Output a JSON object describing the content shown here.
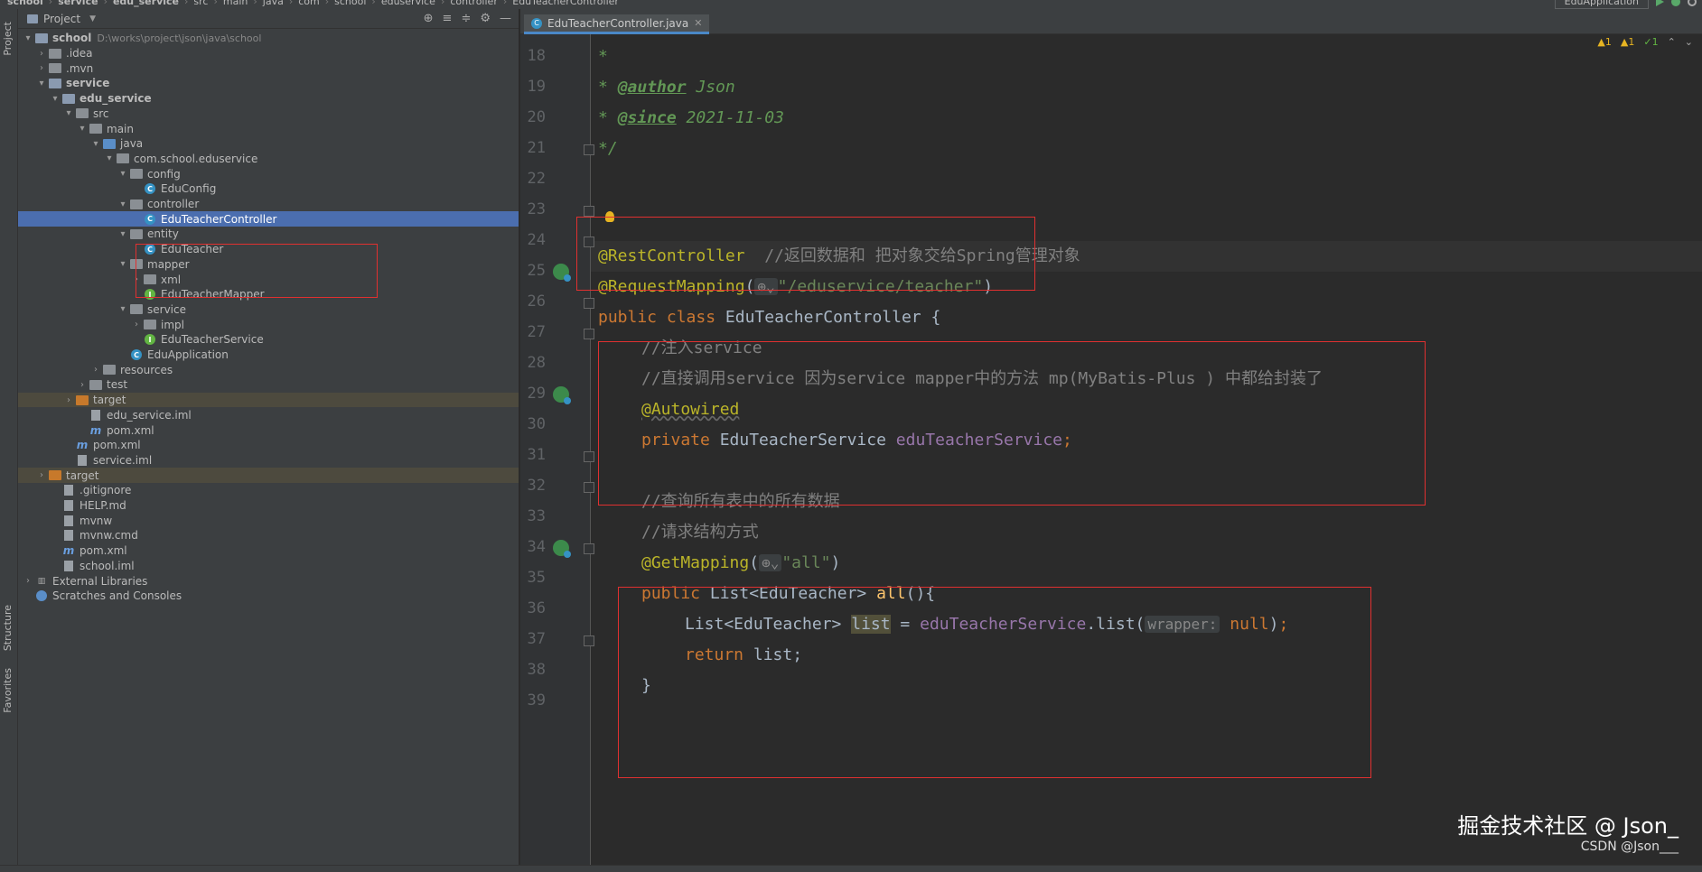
{
  "breadcrumb": [
    "school",
    "service",
    "edu_service",
    "src",
    "main",
    "java",
    "com",
    "school",
    "eduservice",
    "controller",
    "EduTeacherController"
  ],
  "run_config": "EduApplication",
  "left_stripe": {
    "project": "Project",
    "structure": "Structure",
    "favorites": "Favorites"
  },
  "project_panel": {
    "title": "Project"
  },
  "tree": [
    {
      "label": "school",
      "path": "D:\\works\\project\\json\\java\\school",
      "depth": 0,
      "arrow": "▾",
      "icon": "module-folder",
      "bold": true
    },
    {
      "label": ".idea",
      "depth": 1,
      "arrow": "›",
      "icon": "folder"
    },
    {
      "label": ".mvn",
      "depth": 1,
      "arrow": "›",
      "icon": "folder"
    },
    {
      "label": "service",
      "depth": 1,
      "arrow": "▾",
      "icon": "module-folder",
      "bold": true
    },
    {
      "label": "edu_service",
      "depth": 2,
      "arrow": "▾",
      "icon": "module-folder",
      "bold": true
    },
    {
      "label": "src",
      "depth": 3,
      "arrow": "▾",
      "icon": "folder"
    },
    {
      "label": "main",
      "depth": 4,
      "arrow": "▾",
      "icon": "folder"
    },
    {
      "label": "java",
      "depth": 5,
      "arrow": "▾",
      "icon": "folder-blue"
    },
    {
      "label": "com.school.eduservice",
      "depth": 6,
      "arrow": "▾",
      "icon": "folder"
    },
    {
      "label": "config",
      "depth": 7,
      "arrow": "▾",
      "icon": "folder"
    },
    {
      "label": "EduConfig",
      "depth": 8,
      "arrow": "",
      "icon": "class"
    },
    {
      "label": "controller",
      "depth": 7,
      "arrow": "▾",
      "icon": "folder"
    },
    {
      "label": "EduTeacherController",
      "depth": 8,
      "arrow": "",
      "icon": "class",
      "selected": true
    },
    {
      "label": "entity",
      "depth": 7,
      "arrow": "▾",
      "icon": "folder"
    },
    {
      "label": "EduTeacher",
      "depth": 8,
      "arrow": "",
      "icon": "class"
    },
    {
      "label": "mapper",
      "depth": 7,
      "arrow": "▾",
      "icon": "folder"
    },
    {
      "label": "xml",
      "depth": 8,
      "arrow": "›",
      "icon": "folder"
    },
    {
      "label": "EduTeacherMapper",
      "depth": 8,
      "arrow": "",
      "icon": "interface"
    },
    {
      "label": "service",
      "depth": 7,
      "arrow": "▾",
      "icon": "folder"
    },
    {
      "label": "impl",
      "depth": 8,
      "arrow": "›",
      "icon": "folder"
    },
    {
      "label": "EduTeacherService",
      "depth": 8,
      "arrow": "",
      "icon": "interface"
    },
    {
      "label": "EduApplication",
      "depth": 7,
      "arrow": "",
      "icon": "class"
    },
    {
      "label": "resources",
      "depth": 5,
      "arrow": "›",
      "icon": "folder"
    },
    {
      "label": "test",
      "depth": 4,
      "arrow": "›",
      "icon": "folder"
    },
    {
      "label": "target",
      "depth": 3,
      "arrow": "›",
      "icon": "folder-orange",
      "excluded": true
    },
    {
      "label": "edu_service.iml",
      "depth": 4,
      "arrow": "",
      "icon": "file"
    },
    {
      "label": "pom.xml",
      "depth": 4,
      "arrow": "",
      "icon": "maven"
    },
    {
      "label": "pom.xml",
      "depth": 3,
      "arrow": "",
      "icon": "maven"
    },
    {
      "label": "service.iml",
      "depth": 3,
      "arrow": "",
      "icon": "file"
    },
    {
      "label": "target",
      "depth": 1,
      "arrow": "›",
      "icon": "folder-orange",
      "excluded": true
    },
    {
      "label": ".gitignore",
      "depth": 2,
      "arrow": "",
      "icon": "file"
    },
    {
      "label": "HELP.md",
      "depth": 2,
      "arrow": "",
      "icon": "file"
    },
    {
      "label": "mvnw",
      "depth": 2,
      "arrow": "",
      "icon": "file"
    },
    {
      "label": "mvnw.cmd",
      "depth": 2,
      "arrow": "",
      "icon": "file"
    },
    {
      "label": "pom.xml",
      "depth": 2,
      "arrow": "",
      "icon": "maven"
    },
    {
      "label": "school.iml",
      "depth": 2,
      "arrow": "",
      "icon": "file"
    },
    {
      "label": "External Libraries",
      "depth": 0,
      "arrow": "›",
      "icon": "libs"
    },
    {
      "label": "Scratches and Consoles",
      "depth": 0,
      "arrow": "",
      "icon": "scratch"
    }
  ],
  "editor": {
    "tab_label": "EduTeacherController.java",
    "inspections": {
      "warn1": "1",
      "warn2": "1",
      "ok": "1"
    },
    "line_numbers": [
      "18",
      "19",
      "20",
      "21",
      "22",
      "23",
      "24",
      "25",
      "26",
      "27",
      "28",
      "29",
      "30",
      "31",
      "32",
      "33",
      "34",
      "35",
      "36",
      "37",
      "38",
      "39"
    ],
    "code": {
      "l18": "*",
      "l19_tag": "@author",
      "l19_rest": " Json",
      "l20_tag": "@since",
      "l20_rest": " 2021-11-03",
      "l21": "*/",
      "l23_ann": "@RestController",
      "l23_cmt": "  //返回数据和 把对象交给Spring管理对象",
      "l24_ann": "@RequestMapping",
      "l24_str": "\"/eduservice/teacher\"",
      "l25_kw": "public class ",
      "l25_name": "EduTeacherController {",
      "l26": "//注入service",
      "l27": "//直接调用service 因为service mapper中的方法 mp(MyBatis-Plus ) 中都给封装了",
      "l28": "@Autowired",
      "l29_kw": "private ",
      "l29_type": "EduTeacherService ",
      "l29_field": "eduTeacherService",
      "l31": "//查询所有表中的所有数据",
      "l32": "//请求结构方式",
      "l33_ann": "@GetMapping",
      "l33_str": "\"all\"",
      "l34_kw": "public ",
      "l34_type": "List<EduTeacher> ",
      "l34_fn": "all",
      "l35_type": "List<EduTeacher> ",
      "l35_var": "list",
      "l35_field": "eduTeacherService",
      "l35_call": ".list(",
      "l35_hint": "wrapper:",
      "l35_null": "null",
      "l36_kw": "return ",
      "l36_rest": "list;",
      "l37": "}"
    }
  },
  "watermark": {
    "line1": "掘金技术社区 @ Json_",
    "line2": "CSDN @Json___"
  }
}
